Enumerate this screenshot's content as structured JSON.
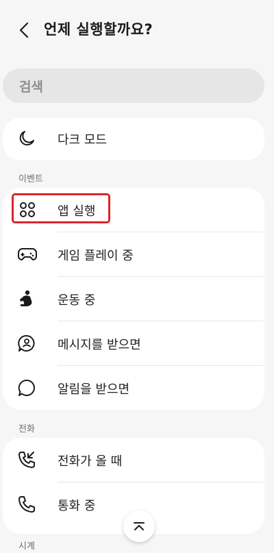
{
  "header": {
    "title": "언제 실행할까요?",
    "back_icon": "back-arrow-icon"
  },
  "search": {
    "label": "검색"
  },
  "top_items": [
    {
      "label": "다크 모드",
      "icon": "moon-icon"
    }
  ],
  "sections": {
    "event": "이벤트",
    "phone": "전화",
    "clock": "시계"
  },
  "event_items": [
    {
      "label": "앱 실행",
      "icon": "app-grid-icon",
      "highlighted": true
    },
    {
      "label": "게임 플레이 중",
      "icon": "gamepad-icon"
    },
    {
      "label": "운동 중",
      "icon": "exercise-icon"
    },
    {
      "label": "메시지를 받으면",
      "icon": "message-icon"
    },
    {
      "label": "알림을 받으면",
      "icon": "notification-bubble-icon"
    }
  ],
  "phone_items": [
    {
      "label": "전화가 올 때",
      "icon": "incoming-call-icon"
    },
    {
      "label": "통화 중",
      "icon": "phone-icon"
    }
  ],
  "colors": {
    "highlight": "#d9262b",
    "background": "#f6f6f6",
    "card": "#ffffff"
  },
  "scroll_top_icon": "scroll-to-top-icon"
}
